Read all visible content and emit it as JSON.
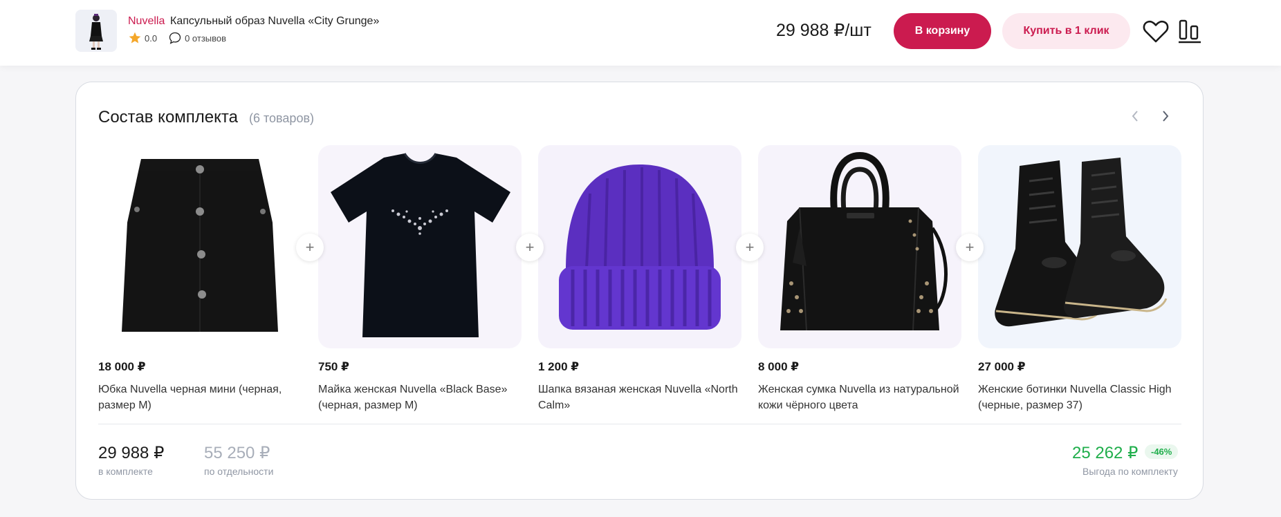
{
  "header": {
    "brand": "Nuvella",
    "title": "Капсульный образ Nuvella «City Grunge»",
    "rating": "0.0",
    "reviews": "0 отзывов",
    "price": "29 988 ₽/шт",
    "cart_label": "В корзину",
    "oneclick_label": "Купить в 1 клик"
  },
  "set": {
    "title": "Состав комплекта",
    "count": "(6 товаров)",
    "items": [
      {
        "price": "18 000 ₽",
        "name": "Юбка Nuvella черная мини (черная, размер M)"
      },
      {
        "price": "750 ₽",
        "name": "Майка женская Nuvella «Black Base» (черная, размер M)"
      },
      {
        "price": "1 200 ₽",
        "name": "Шапка вязаная женская Nuvella «North Calm»"
      },
      {
        "price": "8 000 ₽",
        "name": "Женская сумка Nuvella из натуральной кожи чёрного цвета"
      },
      {
        "price": "27 000 ₽",
        "name": "Женские ботинки Nuvella Classic High (черные, размер 37)"
      }
    ],
    "plus": "+"
  },
  "summary": {
    "set_price": "29 988 ₽",
    "set_label": "в комплекте",
    "separate_price": "55 250 ₽",
    "separate_label": "по отдельности",
    "savings": "25 262 ₽",
    "discount": "-46%",
    "savings_label": "Выгода по комплекту"
  },
  "colors": {
    "accent": "#cb1b4f",
    "accent_soft": "#fce9ef",
    "success": "#1fae4b"
  },
  "icons": [
    "star-icon",
    "comment-icon",
    "heart-icon",
    "compare-icon",
    "chevron-left-icon",
    "chevron-right-icon",
    "plus-icon"
  ]
}
